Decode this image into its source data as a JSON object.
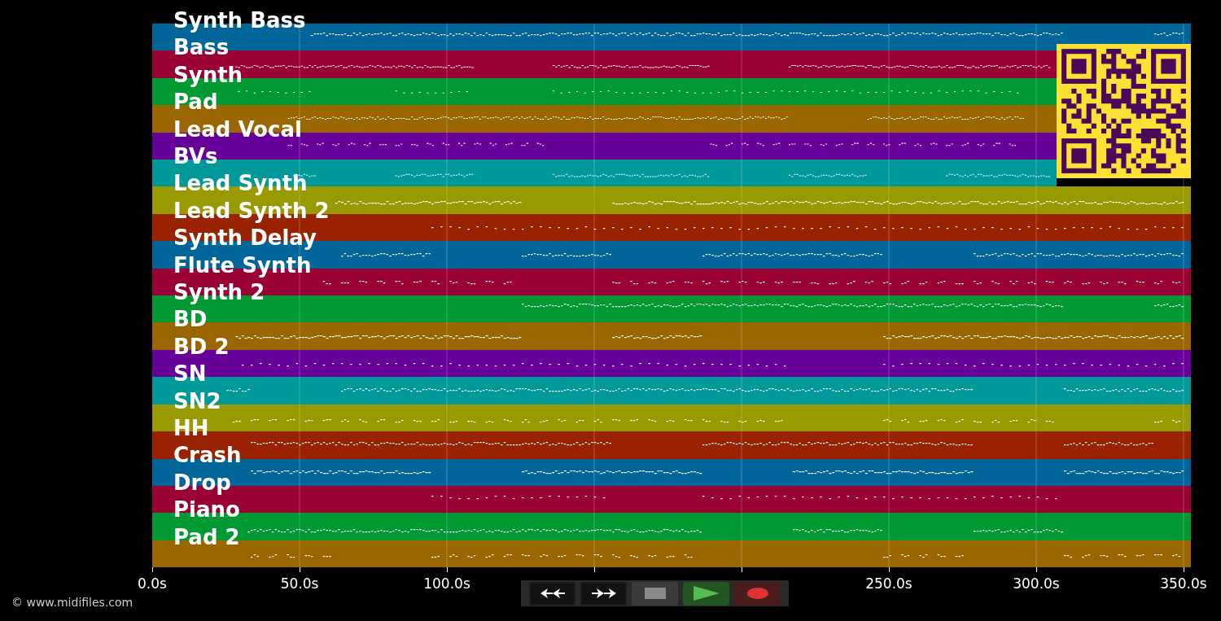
{
  "tracks": [
    {
      "name": "Synth Bass",
      "color": "#006699"
    },
    {
      "name": "Bass",
      "color": "#990033"
    },
    {
      "name": "Synth",
      "color": "#009933"
    },
    {
      "name": "Pad",
      "color": "#996600"
    },
    {
      "name": "Lead Vocal",
      "color": "#660099"
    },
    {
      "name": "BVs",
      "color": "#009999"
    },
    {
      "name": "Lead Synth",
      "color": "#999900"
    },
    {
      "name": "Lead Synth 2",
      "color": "#992200"
    },
    {
      "name": "Synth Delay",
      "color": "#006699"
    },
    {
      "name": "Flute Synth",
      "color": "#990033"
    },
    {
      "name": "Synth 2",
      "color": "#009933"
    },
    {
      "name": "BD",
      "color": "#996600"
    },
    {
      "name": "BD 2",
      "color": "#660099"
    },
    {
      "name": "SN",
      "color": "#009999"
    },
    {
      "name": "SN2",
      "color": "#999900"
    },
    {
      "name": "HH",
      "color": "#992200"
    },
    {
      "name": "Crash",
      "color": "#006699"
    },
    {
      "name": "Drop",
      "color": "#990033"
    },
    {
      "name": "Piano",
      "color": "#009933"
    },
    {
      "name": "Pad 2",
      "color": "#996600"
    }
  ],
  "time_axis": {
    "ticks": [
      {
        "kind": "labeled",
        "label": "0.0s"
      },
      {
        "kind": "labeled",
        "label": "50.0s"
      },
      {
        "kind": "labeled",
        "label": "100.0s"
      },
      {
        "kind": "unlabeled"
      },
      {
        "kind": "unlabeled"
      },
      {
        "kind": "labeled",
        "label": "250.0s"
      },
      {
        "kind": "labeled",
        "label": "300.0s"
      },
      {
        "kind": "labeled",
        "label": "350.0s"
      }
    ]
  },
  "transport": [
    {
      "kind": "rewind"
    },
    {
      "kind": "forward"
    },
    {
      "kind": "stop"
    },
    {
      "kind": "play"
    },
    {
      "kind": "record"
    }
  ],
  "copyright": "© www.midifiles.com"
}
